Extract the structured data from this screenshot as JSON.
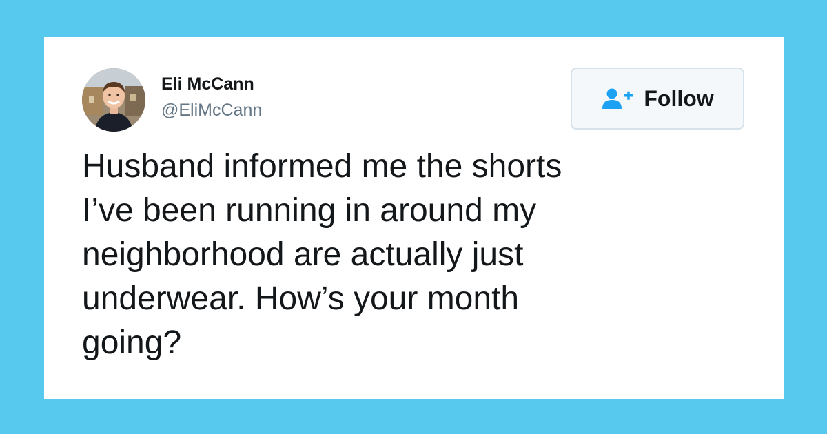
{
  "tweet": {
    "author": {
      "name": "Eli McCann",
      "handle": "@EliMcCann",
      "avatar": "profile-photo"
    },
    "follow_button": {
      "label": "Follow",
      "icon": "add-user-icon"
    },
    "text": "Husband informed me the shorts\nI’ve been running in around my\nneighborhood are actually just\nunderwear. How’s your month\ngoing?"
  },
  "colors": {
    "background": "#57c8ee",
    "card": "#ffffff",
    "accent": "#1da1f2",
    "text": "#14171a",
    "secondary_text": "#657786"
  }
}
